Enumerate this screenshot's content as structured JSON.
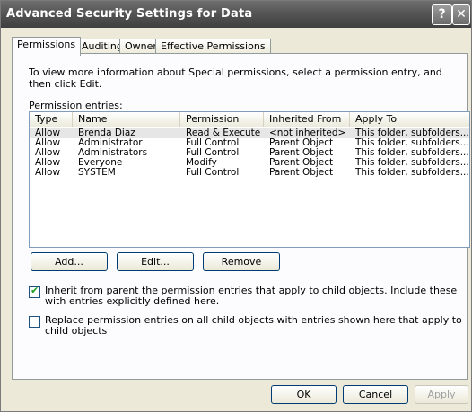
{
  "window": {
    "title": "Advanced Security Settings for Data"
  },
  "titlebar": {
    "help_label": "?",
    "close_label": "✕"
  },
  "tabs": [
    {
      "label": "Permissions",
      "active": true
    },
    {
      "label": "Auditing",
      "active": false
    },
    {
      "label": "Owner",
      "active": false
    },
    {
      "label": "Effective Permissions",
      "active": false
    }
  ],
  "info_text": "To view more information about Special permissions, select a permission entry, and then click Edit.",
  "entries_label": "Permission entries:",
  "columns": [
    "Type",
    "Name",
    "Permission",
    "Inherited From",
    "Apply To"
  ],
  "entries": [
    {
      "type": "Allow",
      "name": "Brenda Diaz",
      "permission": "Read & Execute",
      "inherited_from": "<not inherited>",
      "apply_to": "This folder, subfolders..."
    },
    {
      "type": "Allow",
      "name": "Administrator",
      "permission": "Full Control",
      "inherited_from": "Parent Object",
      "apply_to": "This folder, subfolders..."
    },
    {
      "type": "Allow",
      "name": "Administrators",
      "permission": "Full Control",
      "inherited_from": "Parent Object",
      "apply_to": "This folder, subfolders..."
    },
    {
      "type": "Allow",
      "name": "Everyone",
      "permission": "Modify",
      "inherited_from": "Parent Object",
      "apply_to": "This folder, subfolders..."
    },
    {
      "type": "Allow",
      "name": "SYSTEM",
      "permission": "Full Control",
      "inherited_from": "Parent Object",
      "apply_to": "This folder, subfolders..."
    }
  ],
  "buttons": {
    "add": "Add...",
    "edit": "Edit...",
    "remove": "Remove",
    "ok": "OK",
    "cancel": "Cancel",
    "apply": "Apply"
  },
  "checkboxes": {
    "inherit": {
      "label": "Inherit from parent the permission entries that apply to child objects. Include these with entries explicitly defined here.",
      "checked": true
    },
    "replace": {
      "label": "Replace permission entries on all child objects with entries shown here that apply to child objects",
      "checked": false
    }
  }
}
